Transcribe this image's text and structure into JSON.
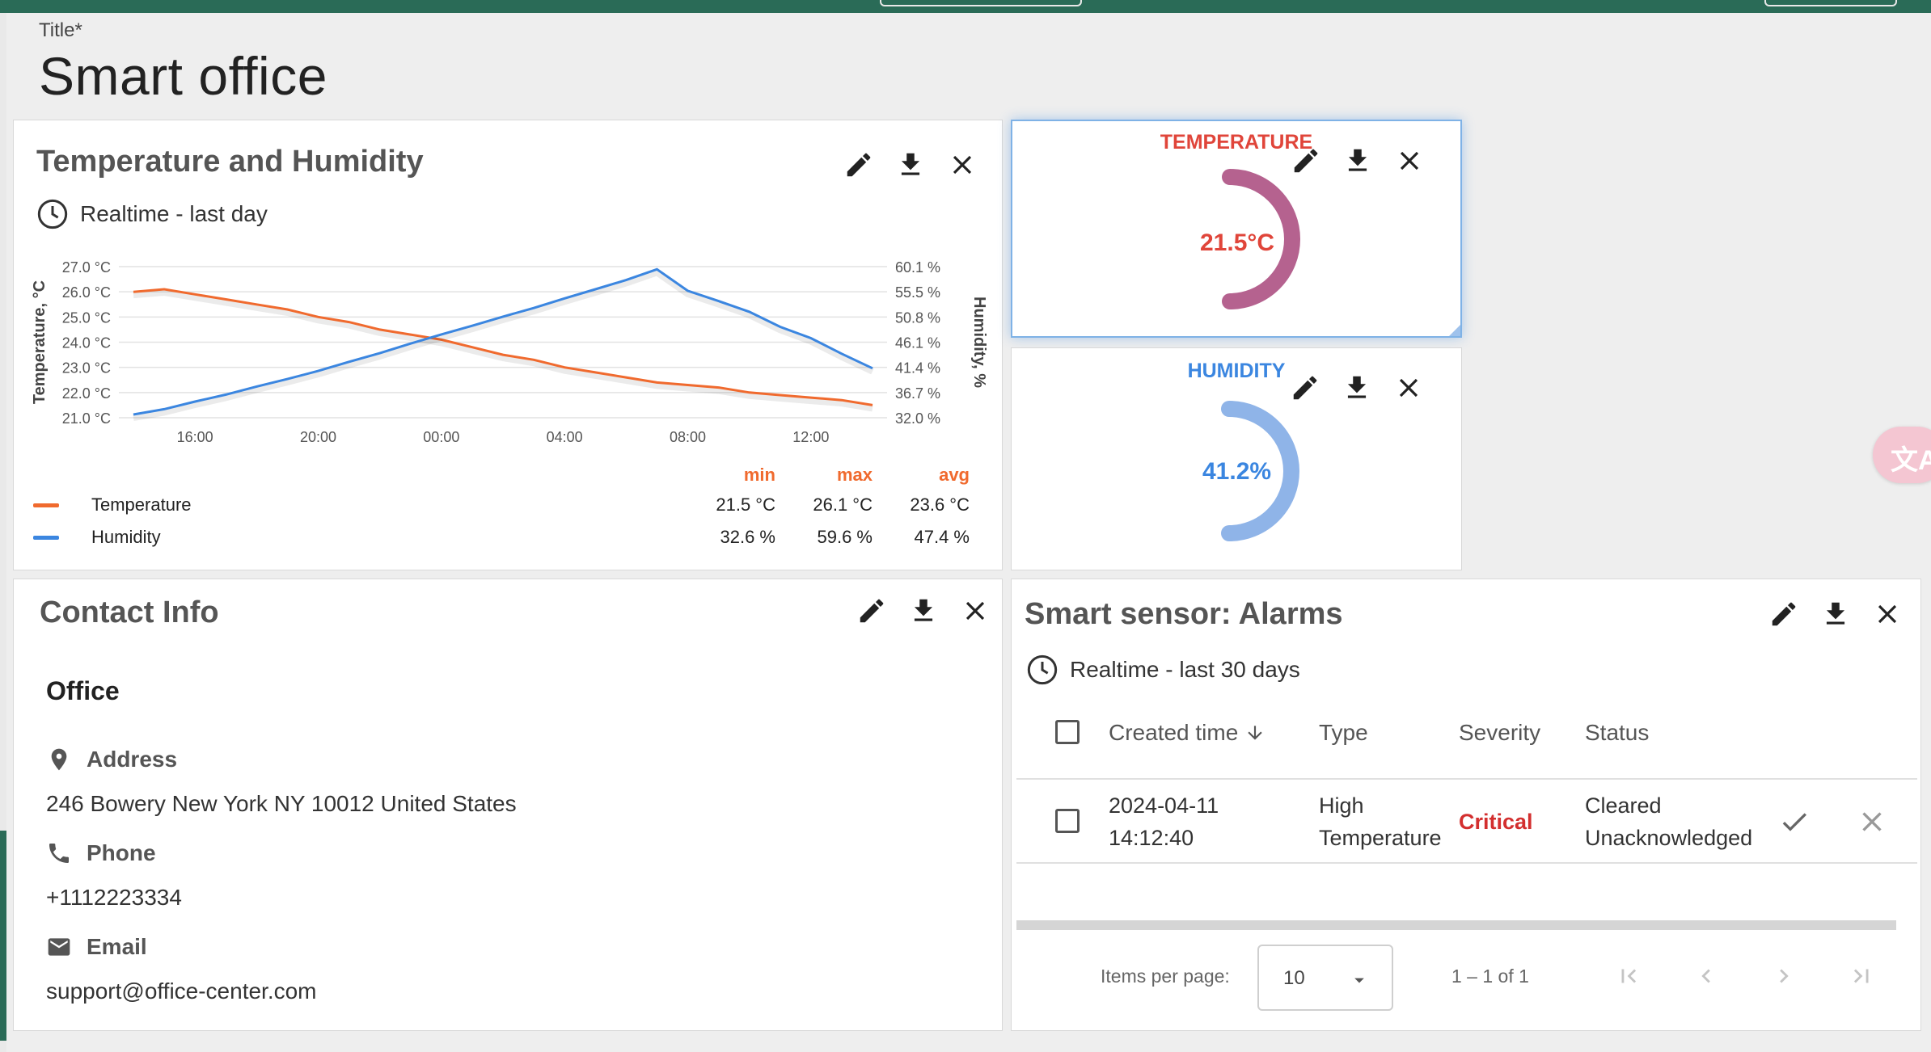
{
  "page": {
    "title_label": "Title*",
    "title": "Smart office"
  },
  "colors": {
    "top_bar": "#2a6b57",
    "temperature": "#f06a2e",
    "humidity": "#3b86e0",
    "gauge_temp": "#b5628f",
    "gauge_temp_label": "#e0453a",
    "gauge_hum": "#8fb4e8",
    "gauge_hum_label": "#3b86e0",
    "critical": "#d32f2f"
  },
  "temp_humidity_widget": {
    "title": "Temperature and Humidity",
    "timewindow": "Realtime - last day",
    "actions": [
      "edit-icon",
      "download-icon",
      "close-icon"
    ],
    "legend": {
      "headers": [
        "min",
        "max",
        "avg"
      ],
      "rows": [
        {
          "name": "Temperature",
          "min": "21.5 °C",
          "max": "26.1 °C",
          "avg": "23.6 °C"
        },
        {
          "name": "Humidity",
          "min": "32.6 %",
          "max": "59.6 %",
          "avg": "47.4 %"
        }
      ]
    }
  },
  "chart_data": {
    "type": "line",
    "x": [
      "14:00",
      "15:00",
      "16:00",
      "17:00",
      "18:00",
      "19:00",
      "20:00",
      "21:00",
      "22:00",
      "23:00",
      "00:00",
      "01:00",
      "02:00",
      "03:00",
      "04:00",
      "05:00",
      "06:00",
      "07:00",
      "08:00",
      "09:00",
      "10:00",
      "11:00",
      "12:00",
      "13:00",
      "14:00"
    ],
    "x_ticks": [
      "16:00",
      "20:00",
      "00:00",
      "04:00",
      "08:00",
      "12:00"
    ],
    "y_left": {
      "label": "Temperature, °C",
      "ticks": [
        "27.0 °C",
        "26.0 °C",
        "25.0 °C",
        "24.0 °C",
        "23.0 °C",
        "22.0 °C",
        "21.0 °C"
      ],
      "ylim": [
        21,
        27
      ]
    },
    "y_right": {
      "label": "Humidity, %",
      "ticks": [
        "60.1 %",
        "55.5 %",
        "50.8 %",
        "46.1 %",
        "41.4 %",
        "36.7 %",
        "32.0 %"
      ],
      "ylim": [
        32.0,
        60.1
      ]
    },
    "grid": true,
    "series": [
      {
        "name": "Temperature",
        "axis": "left",
        "values": [
          26.0,
          26.1,
          25.9,
          25.7,
          25.5,
          25.3,
          25.0,
          24.8,
          24.5,
          24.3,
          24.1,
          23.8,
          23.5,
          23.3,
          23.0,
          22.8,
          22.6,
          22.4,
          22.3,
          22.2,
          22.0,
          21.9,
          21.8,
          21.7,
          21.5
        ]
      },
      {
        "name": "Humidity",
        "axis": "right",
        "values": [
          32.6,
          33.6,
          35.0,
          36.3,
          37.8,
          39.2,
          40.7,
          42.4,
          44.0,
          45.8,
          47.5,
          49.1,
          50.8,
          52.4,
          54.2,
          55.9,
          57.6,
          59.6,
          55.6,
          53.7,
          51.7,
          48.9,
          46.8,
          43.9,
          41.2
        ]
      }
    ]
  },
  "gauges": [
    {
      "title": "TEMPERATURE",
      "value": "21.5°C",
      "fraction": 0.5,
      "actions": [
        "edit-icon",
        "download-icon",
        "close-icon"
      ]
    },
    {
      "title": "HUMIDITY",
      "value": "41.2%",
      "fraction": 0.5,
      "actions": [
        "edit-icon",
        "download-icon",
        "close-icon"
      ]
    }
  ],
  "contact": {
    "title": "Contact Info",
    "office": "Office",
    "address_label": "Address",
    "address": "246 Bowery New York NY 10012 United States",
    "phone_label": "Phone",
    "phone": "+1112223334",
    "email_label": "Email",
    "email": "support@office-center.com",
    "actions": [
      "edit-icon",
      "download-icon",
      "close-icon"
    ]
  },
  "alarms": {
    "title": "Smart sensor: Alarms",
    "timewindow": "Realtime - last 30 days",
    "columns": [
      "Created time",
      "Type",
      "Severity",
      "Status"
    ],
    "rows": [
      {
        "created_date": "2024-04-11",
        "created_time": "14:12:40",
        "type_1": "High",
        "type_2": "Temperature",
        "severity": "Critical",
        "status_1": "Cleared",
        "status_2": "Unacknowledged"
      }
    ],
    "pager": {
      "items_per_page_label": "Items per page:",
      "items_per_page": "10",
      "range": "1 – 1 of 1"
    },
    "actions": [
      "edit-icon",
      "download-icon",
      "close-icon"
    ]
  }
}
